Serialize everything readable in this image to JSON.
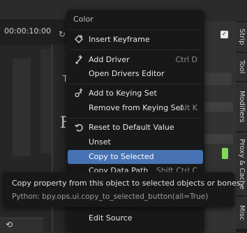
{
  "background": {
    "timecode": "00:00:10:00",
    "field_letter": "T",
    "big_letter": "F",
    "checkbox_mark": "✓"
  },
  "sidebar_tabs": [
    "Strip",
    "Tool",
    "Modifiers",
    "Proxy & Cache",
    "Misc"
  ],
  "menu": {
    "title": "Color",
    "items": [
      {
        "icon": "insert-keyframe-icon",
        "label": "Insert Keyframe",
        "shortcut": ""
      },
      {
        "icon": "add-driver-icon",
        "label": "Add Driver",
        "shortcut": "Ctrl D"
      },
      {
        "icon": "",
        "label": "Open Drivers Editor",
        "shortcut": ""
      },
      {
        "icon": "keying-set-icon",
        "label": "Add to Keying Set",
        "shortcut": ""
      },
      {
        "icon": "",
        "label": "Remove from Keying Set",
        "shortcut": "Alt K"
      },
      {
        "icon": "reset-icon",
        "label": "Reset to Default Value",
        "shortcut": ""
      },
      {
        "icon": "",
        "label": "Unset",
        "shortcut": ""
      },
      {
        "icon": "",
        "label": "Copy to Selected",
        "shortcut": ""
      },
      {
        "icon": "",
        "label": "Copy Data Path",
        "shortcut": "Shift Ctrl C"
      },
      {
        "icon": "",
        "label": "Edit Source",
        "shortcut": ""
      }
    ]
  },
  "tooltip": {
    "description": "Copy property from this object to selected objects or bones.",
    "python": "Python: bpy.ops.ui.copy_to_selected_button(all=True)"
  },
  "colors": {
    "highlight": "#4772b3",
    "menu_bg": "#181818",
    "accent_green": "#7ed957"
  }
}
